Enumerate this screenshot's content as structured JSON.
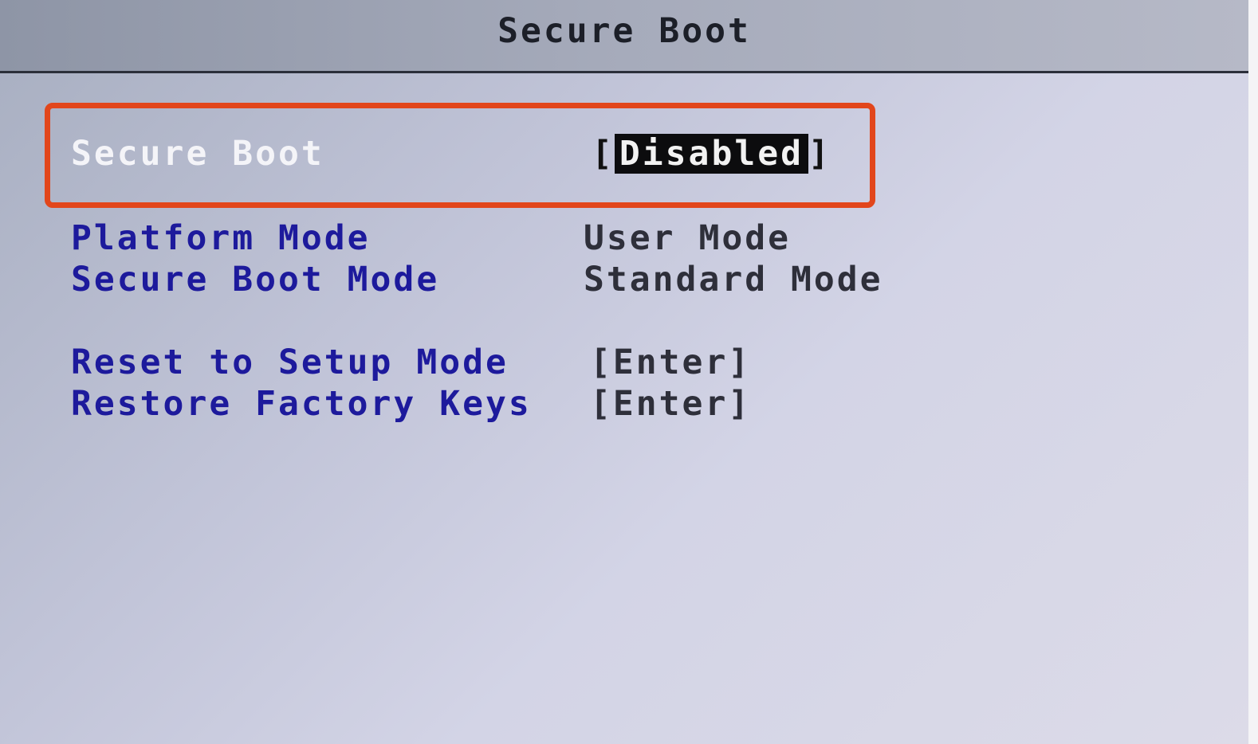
{
  "header": {
    "title": "Secure Boot"
  },
  "settings": [
    {
      "label": "Secure Boot",
      "value": "Disabled",
      "selected": true
    },
    {
      "label": "Platform Mode",
      "value": "User Mode"
    },
    {
      "label": "Secure Boot Mode",
      "value": "Standard Mode"
    },
    {
      "label": "Reset to Setup Mode",
      "value": "[Enter]"
    },
    {
      "label": "Restore Factory Keys",
      "value": "[Enter]"
    }
  ],
  "colors": {
    "label": "#1d1a9c",
    "selected_label": "#f4f4f8",
    "highlight_outline": "#e2461b",
    "value_text": "#2e2f3a",
    "selected_value_bg": "#0c0c0e"
  }
}
